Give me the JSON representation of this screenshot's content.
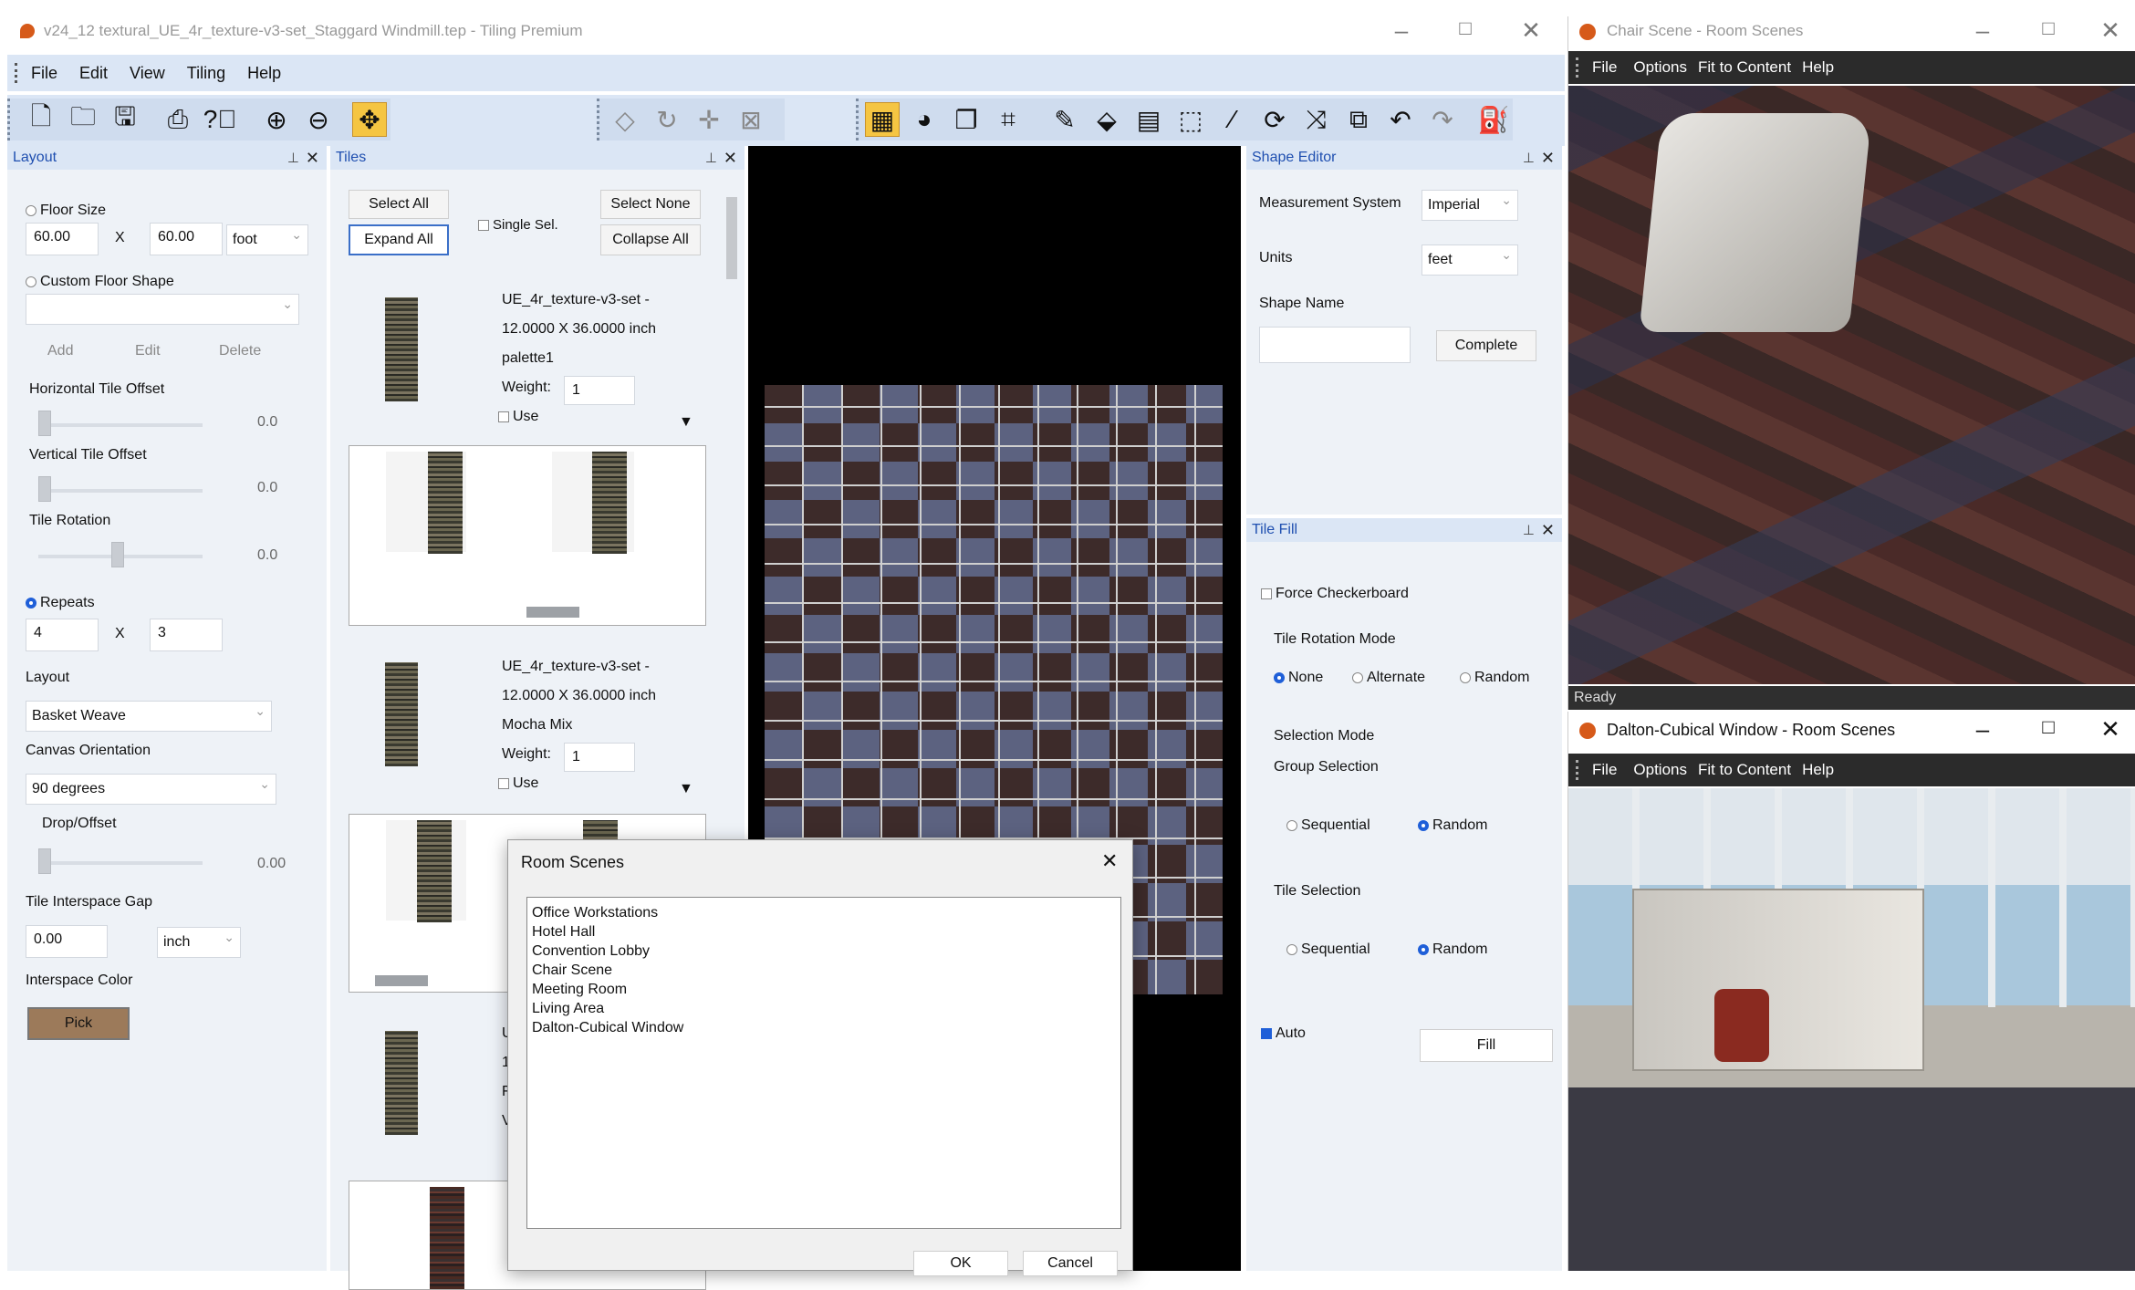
{
  "main_window": {
    "title": "v24_12 textural_UE_4r_texture-v3-set_Staggard Windmill.tep - Tiling Premium",
    "menu": [
      "File",
      "Edit",
      "View",
      "Tiling",
      "Help"
    ]
  },
  "toolbar": {
    "icons": [
      "new-file-icon",
      "open-folder-icon",
      "save-icon",
      "print-icon",
      "help-icon",
      "zoom-in-icon",
      "zoom-out-icon",
      "pan-icon",
      "shape-icon",
      "rotate-icon",
      "move-icon",
      "fit-icon",
      "grid-icon",
      "palette-icon",
      "copy-icon",
      "crop-icon",
      "pencil-icon",
      "eraser-icon",
      "layers-icon",
      "select-icon",
      "brush-icon",
      "refresh-icon",
      "shuffle-icon",
      "duplicate-icon",
      "undo-icon",
      "redo-icon",
      "fill-icon"
    ]
  },
  "layout_panel": {
    "header": "Layout",
    "floor_size_label": "Floor Size",
    "floor_w": "60.00",
    "x1": "X",
    "floor_h": "60.00",
    "floor_unit": "foot",
    "custom_shape_label": "Custom Floor Shape",
    "add": "Add",
    "edit": "Edit",
    "delete": "Delete",
    "h_offset_label": "Horizontal Tile Offset",
    "h_offset_val": "0.0",
    "v_offset_label": "Vertical Tile Offset",
    "v_offset_val": "0.0",
    "rotation_label": "Tile Rotation",
    "rotation_val": "0.0",
    "repeats_label": "Repeats",
    "repeat_a": "4",
    "x2": "X",
    "repeat_b": "3",
    "layout_label": "Layout",
    "layout_val": "Basket Weave",
    "orientation_label": "Canvas Orientation",
    "orientation_val": "90 degrees",
    "drop_label": "Drop/Offset",
    "drop_val": "0.00",
    "gap_label": "Tile Interspace Gap",
    "gap_val": "0.00",
    "gap_unit": "inch",
    "color_label": "Interspace Color",
    "pick": "Pick"
  },
  "tiles_panel": {
    "header": "Tiles",
    "select_all": "Select All",
    "single_sel": "Single Sel.",
    "select_none": "Select None",
    "expand_all": "Expand All",
    "collapse_all": "Collapse All",
    "tile1": {
      "name": "UE_4r_texture-v3-set -",
      "size": "12.0000 X 36.0000 inch",
      "palette": "palette1",
      "weight_label": "Weight:",
      "weight": "1",
      "use": "Use"
    },
    "tile2": {
      "name": "UE_4r_texture-v3-set -",
      "size": "12.0000 X 36.0000 inch",
      "palette": "Mocha Mix",
      "weight_label": "Weight:",
      "weight": "1",
      "use": "Use"
    },
    "tile3_partial": [
      "U",
      "1",
      "F",
      "V"
    ]
  },
  "shape_editor": {
    "header": "Shape Editor",
    "measurement_label": "Measurement System",
    "measurement_val": "Imperial",
    "units_label": "Units",
    "units_val": "feet",
    "shape_name_label": "Shape Name",
    "complete": "Complete"
  },
  "tile_fill": {
    "header": "Tile Fill",
    "force_checkerboard": "Force Checkerboard",
    "rotation_mode_label": "Tile Rotation Mode",
    "rot_none": "None",
    "rot_alternate": "Alternate",
    "rot_random": "Random",
    "selection_mode_label": "Selection Mode",
    "group_selection_label": "Group Selection",
    "group_sequential": "Sequential",
    "group_random": "Random",
    "tile_selection_label": "Tile Selection",
    "tile_sequential": "Sequential",
    "tile_random": "Random",
    "auto": "Auto",
    "fill": "Fill"
  },
  "room_scenes_dialog": {
    "title": "Room Scenes",
    "items": [
      "Office Workstations",
      "Hotel Hall",
      "Convention Lobby",
      "Chair Scene",
      "Meeting Room",
      "Living Area",
      "Dalton-Cubical Window"
    ],
    "ok": "OK",
    "cancel": "Cancel"
  },
  "chair_window": {
    "title": "Chair Scene - Room Scenes",
    "menu": [
      "File",
      "Options",
      "Fit to Content",
      "Help"
    ],
    "status": "Ready"
  },
  "dalton_window": {
    "title": "Dalton-Cubical Window - Room Scenes",
    "menu": [
      "File",
      "Options",
      "Fit to Content",
      "Help"
    ]
  },
  "colors": {
    "accent": "#1f5fd8",
    "panel_header": "#dbe6f5",
    "panel_bg": "#eef2f7",
    "pick_swatch": "#9c7a5a"
  }
}
